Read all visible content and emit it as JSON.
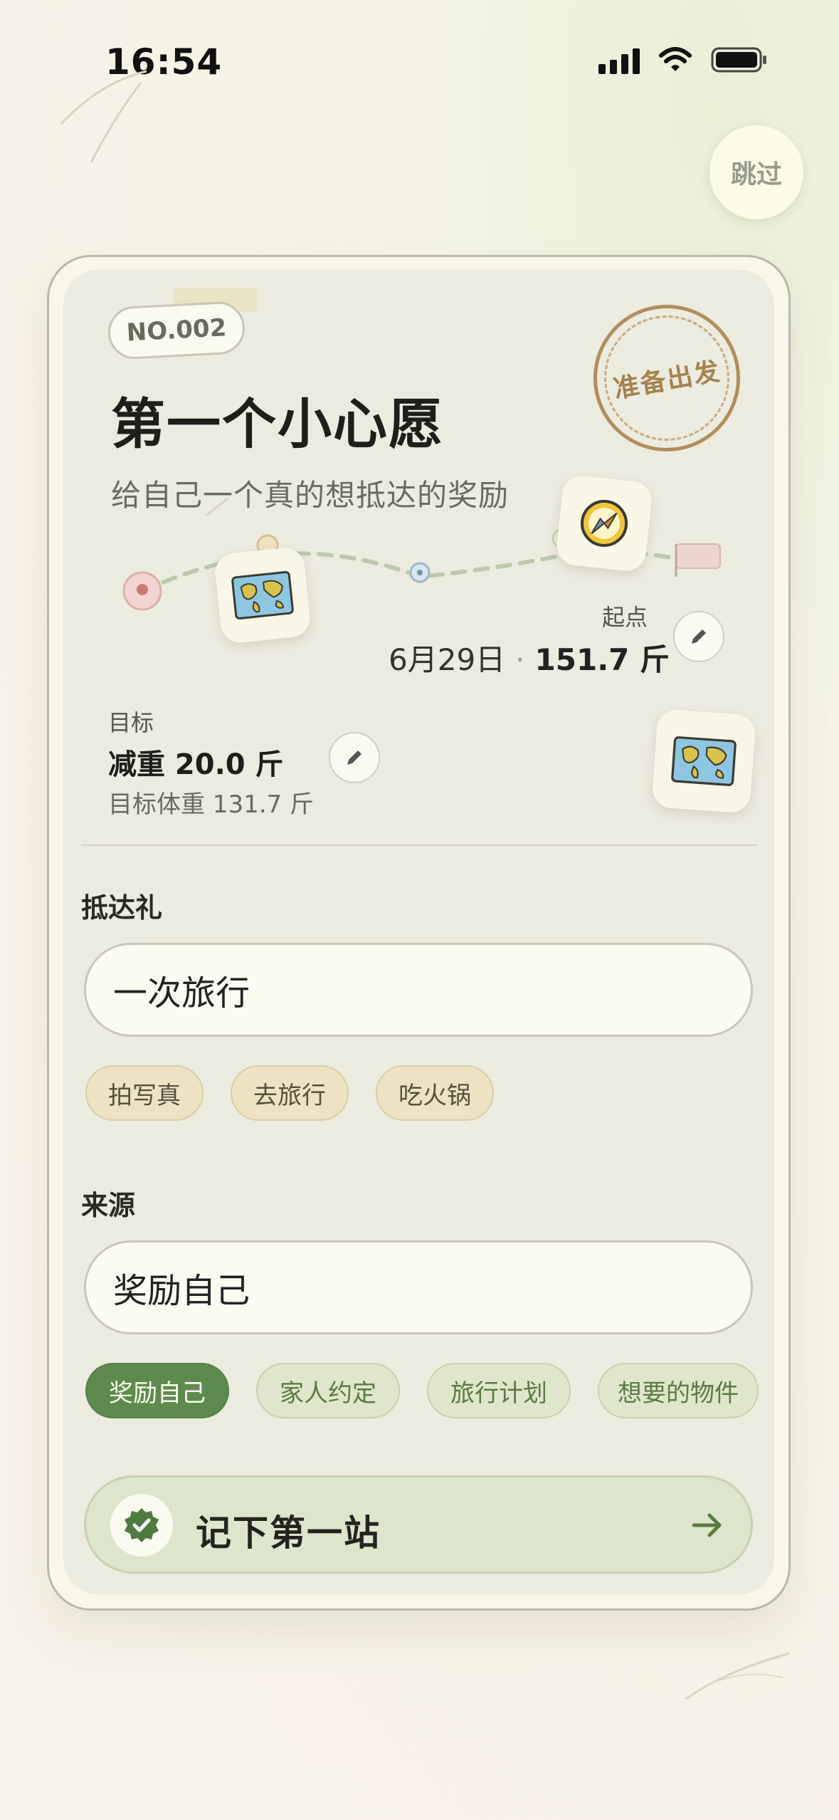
{
  "status_bar": {
    "time": "16:54"
  },
  "skip_label": "跳过",
  "card": {
    "number": "NO.002",
    "stamp": "准备出发",
    "title": "第一个小心愿",
    "subtitle": "给自己一个真的想抵达的奖励"
  },
  "start": {
    "label": "起点",
    "date": "6月29日",
    "separator": "·",
    "weight": "151.7 斤"
  },
  "goal": {
    "label": "目标",
    "value": "减重 20.0 斤",
    "target": "目标体重 131.7 斤"
  },
  "reward": {
    "label": "抵达礼",
    "value": "一次旅行",
    "suggestions": [
      "拍写真",
      "去旅行",
      "吃火锅"
    ]
  },
  "source": {
    "label": "来源",
    "value": "奖励自己",
    "options": [
      "奖励自己",
      "家人约定",
      "旅行计划",
      "想要的物件"
    ],
    "selected": "奖励自己"
  },
  "cta": {
    "label": "记下第一站"
  },
  "icons": {
    "signal": "signal-icon",
    "wifi": "wifi-icon",
    "battery": "battery-icon",
    "edit": "pencil-icon",
    "map": "map-icon",
    "compass": "compass-icon",
    "check": "check-badge-icon",
    "arrow": "arrow-right-icon"
  },
  "colors": {
    "accent_green": "#5f8a4f",
    "stamp_brown": "#a48350",
    "chip_warm": "#ede3c4"
  }
}
